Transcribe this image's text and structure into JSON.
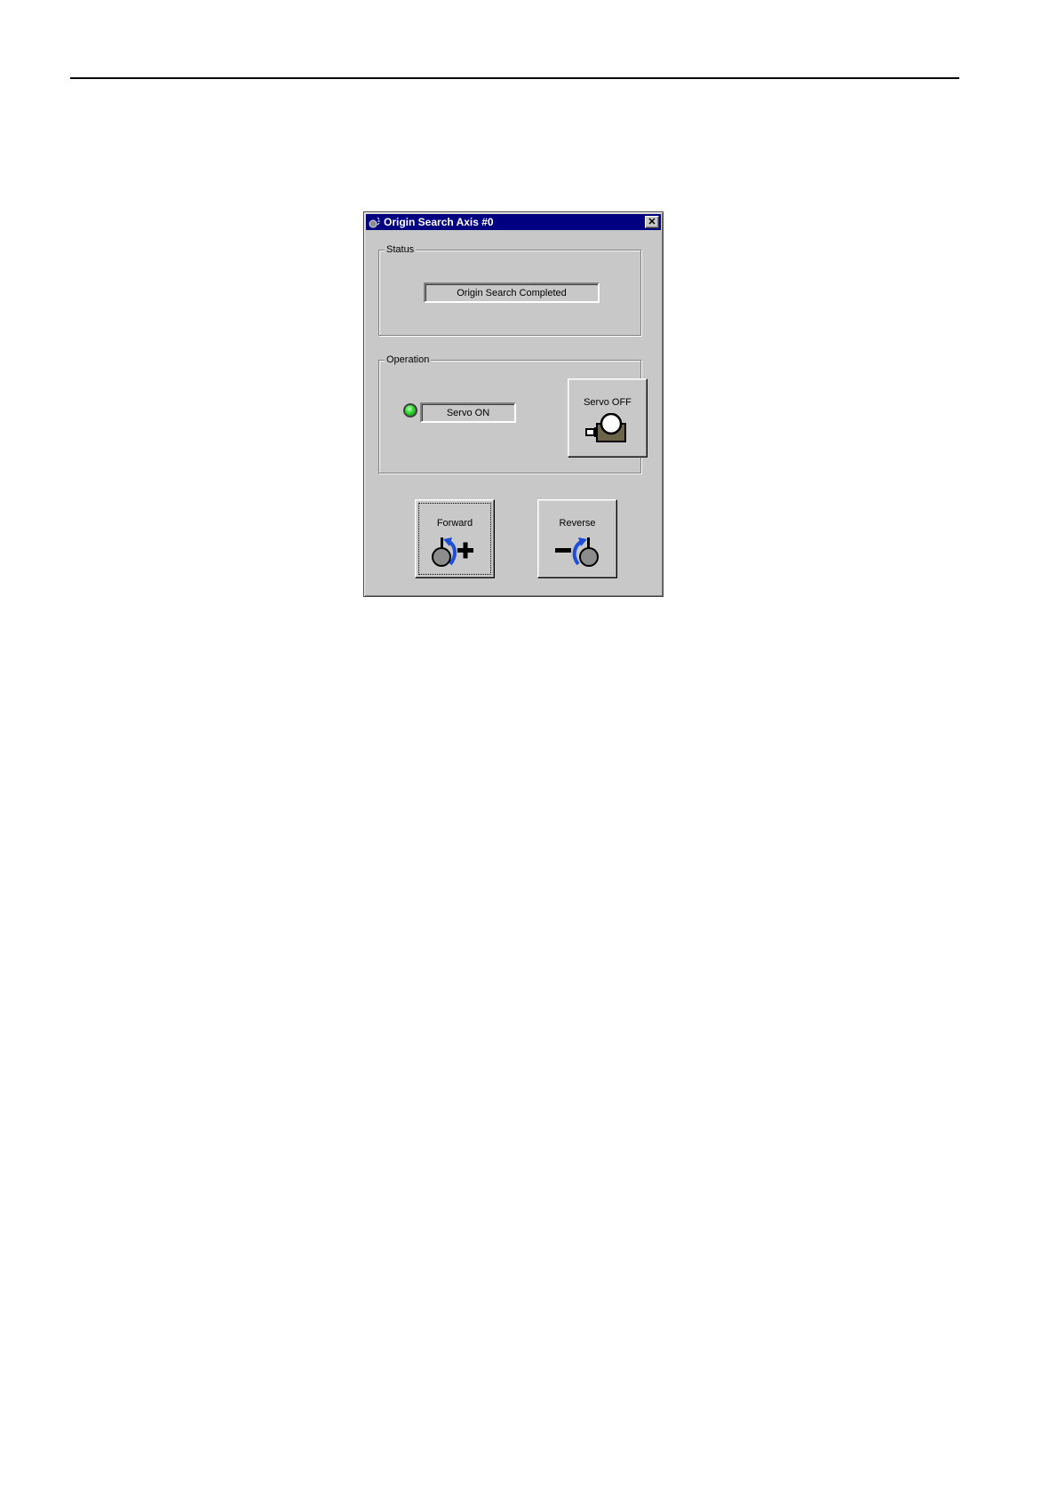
{
  "window": {
    "title": "Origin Search Axis #0",
    "close_label": "✕"
  },
  "status_group": {
    "label": "Status",
    "status_text": "Origin Search Completed"
  },
  "operation_group": {
    "label": "Operation",
    "servo_state_text": "Servo ON",
    "servo_led_color": "#2ed82e",
    "servo_off_button_label": "Servo OFF",
    "servo_off_icon": "servo-motor-icon"
  },
  "motion_buttons": {
    "forward_label": "Forward",
    "forward_icon": "rotate-forward-plus-icon",
    "reverse_label": "Reverse",
    "reverse_icon": "rotate-reverse-minus-icon"
  },
  "colors": {
    "titlebar": "#000080",
    "dialog_face": "#c8c8c8",
    "arrow_blue": "#1f4fd8"
  }
}
